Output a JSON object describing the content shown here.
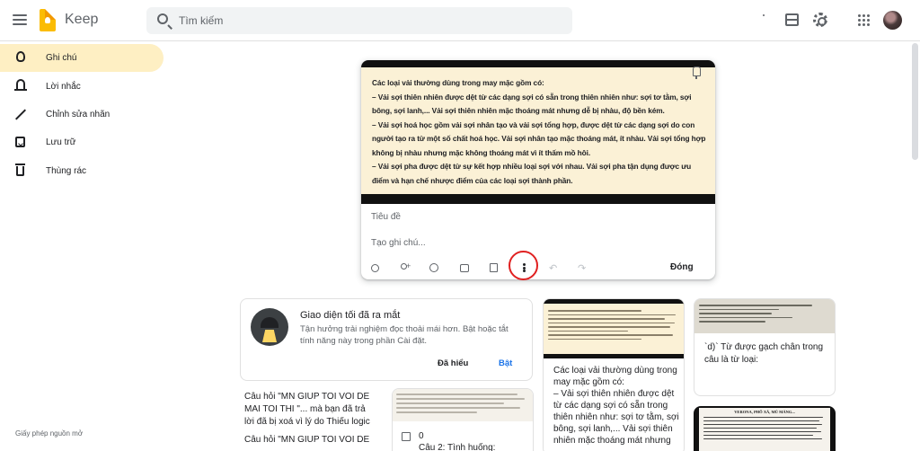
{
  "app": {
    "title": "Keep"
  },
  "search": {
    "placeholder": "Tìm kiếm"
  },
  "sidebar": {
    "items": [
      {
        "label": "Ghi chú",
        "icon": "lightbulb-icon",
        "active": true
      },
      {
        "label": "Lời nhắc",
        "icon": "bell-icon"
      },
      {
        "label": "Chỉnh sửa nhãn",
        "icon": "pencil-icon"
      },
      {
        "label": "Lưu trữ",
        "icon": "archive-icon"
      },
      {
        "label": "Thùng rác",
        "icon": "trash-icon"
      }
    ],
    "footer_link": "Giấy phép nguồn mở"
  },
  "editor": {
    "image_text": [
      "Các loại vải thường dùng trong may mặc gồm có:",
      "– Vải sợi thiên nhiên được dệt từ các dạng sợi có sẵn trong thiên nhiên như: sợi tơ tằm, sợi bông, sợi lanh,... Vải sợi thiên nhiên mặc thoáng mát nhưng dễ bị nhàu, độ bền kém.",
      "– Vải sợi hoá học gồm vải sợi nhân tạo và vải sợi tổng hợp, được dệt từ các dạng sợi do con người tạo ra từ một số chất hoá học. Vải sợi nhân tạo mặc thoáng mát, ít nhàu. Vải sợi tổng hợp không bị nhàu nhưng mặc không thoáng mát vì ít thấm mồ hôi.",
      "– Vải sợi pha được dệt từ sự kết hợp nhiều loại sợi với nhau. Vải sợi pha tận dụng được ưu điểm và hạn chế nhược điểm của các loại sợi thành phần."
    ],
    "title_placeholder": "Tiêu đề",
    "body_placeholder": "Tạo ghi chú...",
    "close_label": "Đóng",
    "highlight_color": "#e02020"
  },
  "promo": {
    "title": "Giao diện tối đã ra mắt",
    "text": "Tận hưởng trải nghiệm đọc thoải mái hơn. Bật hoặc tắt tính năng này trong phần Cài đặt.",
    "dismiss_label": "Đã hiểu",
    "open_label": "Bật"
  },
  "notes": [
    {
      "text": "Câu hỏi \"MN GIUP TOI VOI DE MAI TOI THI \"... mà bạn đã trả lời đã bị xoá vì lý do Thiếu logic",
      "text2": "Câu hỏi \"MN GIUP TOI VOI DE"
    },
    {
      "check_label": "0",
      "line2": "Câu 2: Tình huống:"
    },
    {
      "text": "Các loại vải thường dùng trong may mặc gồm có:\n– Vải sợi thiên nhiên được dệt từ các dạng sợi có sẵn trong thiên nhiên như: sợi tơ tằm, sợi bông, sợi lanh,... Vải sợi thiên nhiên mặc thoáng mát nhưng"
    },
    {
      "text": "`d)` Từ được gạch chân trong câu là từ loại:"
    },
    {
      "header": "VERONA, PHỐ XÁ, MÙ MẢNG..."
    }
  ],
  "colors": {
    "accent": "#fbbc04",
    "active_nav": "#feefc3",
    "link": "#1a73e8"
  }
}
